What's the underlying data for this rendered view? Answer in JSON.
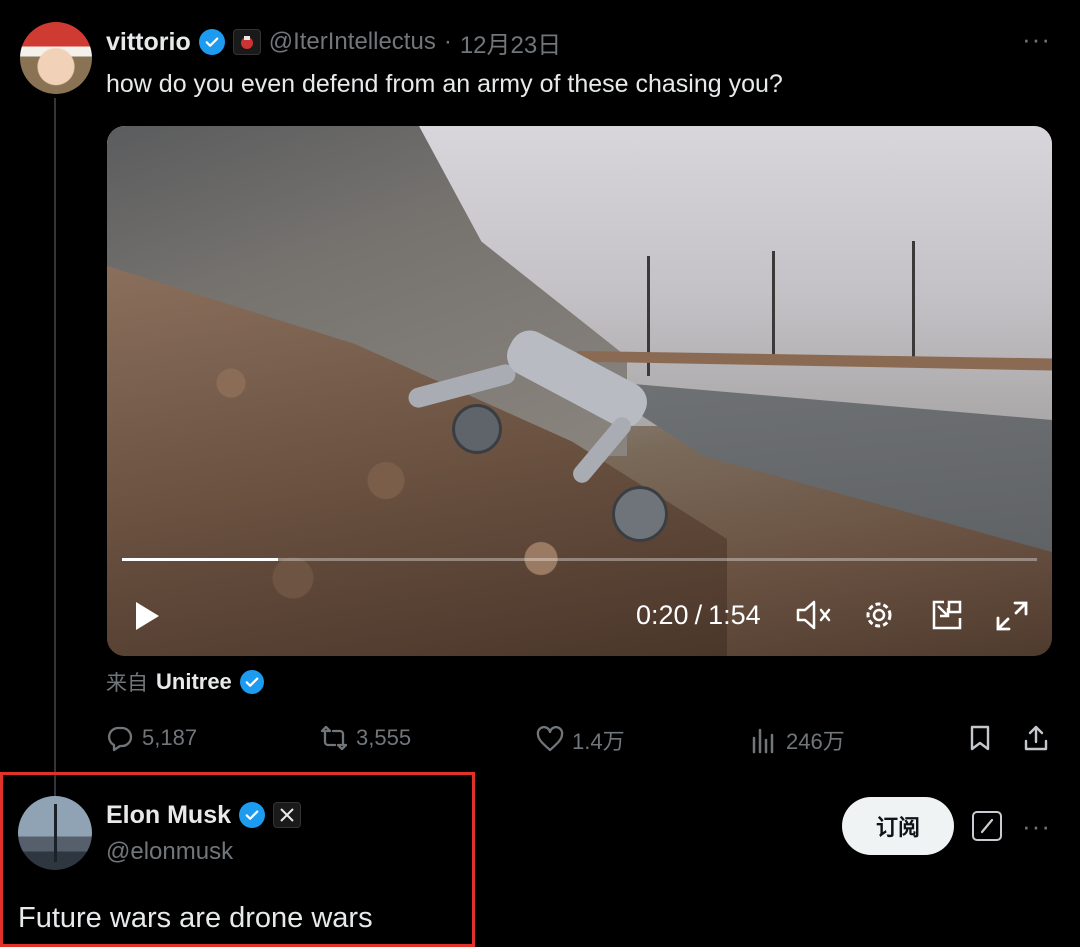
{
  "original_tweet": {
    "display_name": "vittorio",
    "handle": "@IterIntellectus",
    "date_sep": "·",
    "date": "12月23日",
    "more": "···",
    "text": "how do you even defend from an army of these chasing you?",
    "video": {
      "current_time": "0:20",
      "separator": "/",
      "duration": "1:54",
      "progress": 0.17
    },
    "source": {
      "prefix": "来自",
      "name": "Unitree"
    },
    "actions": {
      "replies": "5,187",
      "reposts": "3,555",
      "likes": "1.4万",
      "views": "246万"
    }
  },
  "reply_tweet": {
    "display_name": "Elon Musk",
    "handle": "@elonmusk",
    "subscribe_label": "订阅",
    "more": "···",
    "text": "Future wars are drone wars"
  },
  "colors": {
    "background": "#000000",
    "verified": "#1d9bf0",
    "muted_text": "#71767b",
    "highlight_border": "#e0312b"
  }
}
